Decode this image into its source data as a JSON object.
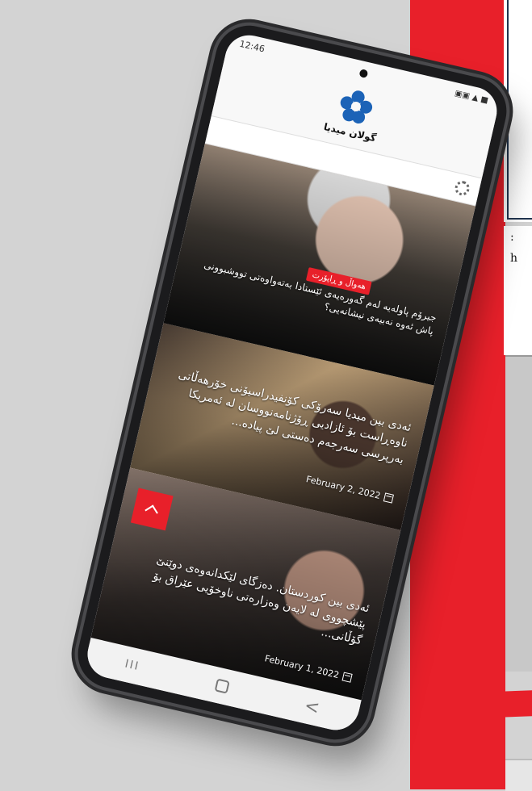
{
  "status_bar": {
    "time": "12:46",
    "right_icons": "▣▣ ▲ ■"
  },
  "header": {
    "logo_text": "گولان میدیا"
  },
  "articles": [
    {
      "badge": "هەواڵ و ڕاپۆرت",
      "title": "جیرۆم پاولەیە لەم گەورەیەی ئێستادا بەتەواوەتی تووشبوونی پاش ئەوە نەبیەی نیشانەیی؟",
      "date": ""
    },
    {
      "badge": "",
      "title": "ئەدی بین میدیا سەرۆکی کۆنفیدراسیۆنی خۆرهەڵاتی ناوەڕاست بۆ ئازادیی ڕۆژنامەنووسان لە ئەمریکا بەرپرسی سەرجەم دەستی لێ پیادە...",
      "date": "February 2, 2022"
    },
    {
      "badge": "",
      "title": "ئەدی بین کوردستان. دەزگای لێکدانەوەی دوێنێ پێشچووی لە لایەن وەزارەتی ناوخۆیی عێراق بۆ گۆڵانی...",
      "date": "February 1, 2022"
    }
  ],
  "navigation": {
    "recent_symbol": "III",
    "back_symbol": "<"
  },
  "background": {
    "doc_lines": [
      ":",
      "h"
    ]
  },
  "colors": {
    "accent_red": "#e8202a",
    "brand_blue": "#1c63b7"
  }
}
